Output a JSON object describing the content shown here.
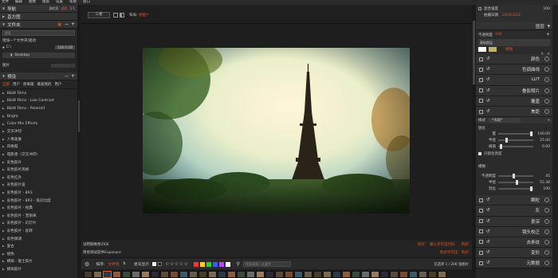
{
  "menubar": [
    "文件",
    "编辑",
    "图像",
    "图层",
    "设置",
    "帮助",
    "窗口"
  ],
  "left": {
    "nav_title": "导航",
    "nav_opts": [
      "翻转屏",
      "适合",
      "1:1"
    ],
    "histogram_title": "直方图",
    "folder_title": "文件夹",
    "folder_search_placeholder": "搜索",
    "add_folder_label": "增加一个文件夹/驱动",
    "drive_label": "C:\\",
    "drive_size": "100.0 GB",
    "desktop_label": "Desktop",
    "folder_footer": "图片",
    "presets_title": "预设",
    "preset_tabs": [
      "全部",
      "用户",
      "原来版",
      "最爱我的",
      "用户"
    ],
    "presets": [
      "B&W Films",
      "B&W Films - Low Contrast",
      "B&W Films - Polaroid",
      "Bright",
      "Color Mix Effects",
      "交叉冲印",
      "人像柔肤",
      "风格鼓",
      "电影感（交叉冲印）",
      "彩色胶片",
      "彩色胶片风格",
      "彩色红外",
      "彩色胶片盖",
      "彩色胶片 - 8R3",
      "彩色胶片 - 8R3 - 低对比度",
      "彩色胶片 - 经典",
      "彩色胶片 - 宝丽来",
      "彩色胶片 - 幻灯片",
      "彩色胶片 - 反转",
      "彩色微调",
      "复古",
      "褪色",
      "模拟 - 富士胶片",
      "模拟胶片"
    ]
  },
  "toolbar_top": {
    "mode_label": "三者",
    "view_label": "布局:",
    "view_value": "原图"
  },
  "status": {
    "line1": "试用期剩余29天",
    "line2": "简易调试软件Exposure",
    "link1": "购买",
    "link2": "输入许可证代码",
    "link3": "购买",
    "link4": "购买许可证",
    "link5": "购买"
  },
  "bottom_bar": {
    "sort_label": "排序:",
    "sort_value": "文件名",
    "filter_label": "星号显示",
    "search_placeholder": "搜索或输入关键字",
    "count": "已选择 1 / 200 张图片"
  },
  "colors": {
    "accent": "#e05a28",
    "swatches": [
      "#ff3030",
      "#ffd500",
      "#30d030",
      "#3060ff",
      "#c040ff",
      "#ffffff"
    ]
  },
  "right": {
    "overall_label": "混合强度",
    "overall_value": "100",
    "date_label": "拍摄日期",
    "date_value": "2019/12/2",
    "layers_title": "图层",
    "opacity_label": "不透明度",
    "opacity_value": "100",
    "layer_name": "基础图层",
    "layer_badge": "原图",
    "panels_top": [
      "颜色",
      "色调曲线",
      "LUT",
      "叠影照片",
      "覆盖",
      "焦距"
    ],
    "style_label": "样式",
    "style_value": "*光斑*",
    "sharpen_title": "锐化",
    "sharpen_rows": [
      {
        "label": "量",
        "value": "100.00"
      },
      {
        "label": "半径",
        "value": "25.00"
      },
      {
        "label": "阈值",
        "value": "0.00"
      }
    ],
    "only_lum": "只锐化亮度",
    "blur_title": "模糊",
    "blur_rows": [
      {
        "label": "不透明度",
        "value": "45"
      },
      {
        "label": "半径",
        "value": "55.38"
      },
      {
        "label": "羽化",
        "value": "100"
      }
    ],
    "panels_bottom": [
      "颗粒",
      "灰",
      "景深",
      "镜头校正",
      "去条纹",
      "变形",
      "元数据"
    ]
  }
}
